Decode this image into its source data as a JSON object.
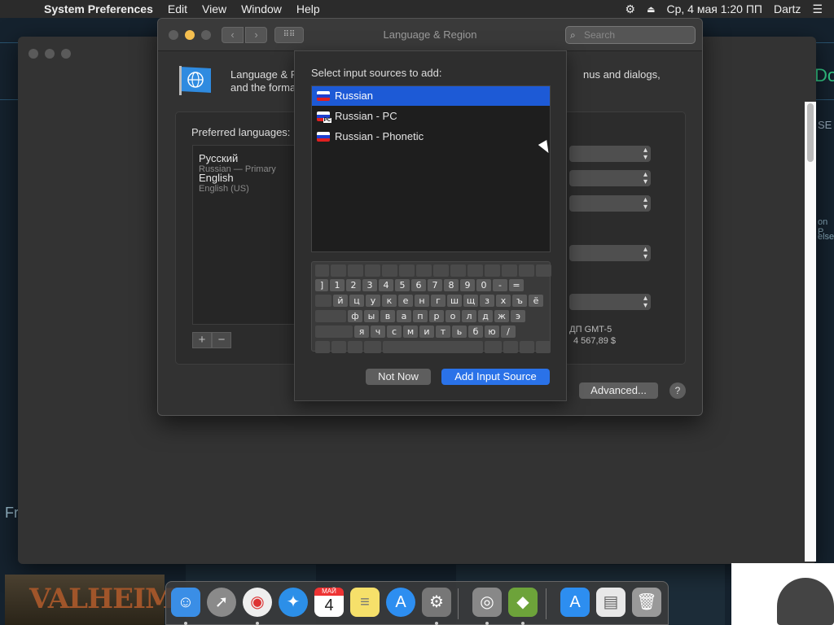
{
  "menubar": {
    "apple": "",
    "app_name": "System Preferences",
    "items": [
      "Edit",
      "View",
      "Window",
      "Help"
    ],
    "clock": "Ср, 4 мая  1:20 ПП",
    "user": "Dartz"
  },
  "window": {
    "title": "Language & Region",
    "search_placeholder": "Search",
    "header_text_line1": "Language & R",
    "header_text_line2": "and the forma",
    "header_text_right": "nus and dialogs,",
    "preferred_languages_label": "Preferred languages:",
    "languages": [
      {
        "name": "Русский",
        "sub": "Russian — Primary"
      },
      {
        "name": "English",
        "sub": "English (US)"
      }
    ],
    "region_time_text": "9 ДП GMT-5",
    "region_number_text": "4 567,89 $",
    "advanced_label": "Advanced...",
    "help_label": "?"
  },
  "sheet": {
    "title": "Select input sources to add:",
    "sources": [
      {
        "label": "Russian",
        "selected": true
      },
      {
        "label": "Russian - PC",
        "selected": false
      },
      {
        "label": "Russian - Phonetic",
        "selected": false
      }
    ],
    "keyboard_rows": [
      [
        "]",
        "1",
        "2",
        "3",
        "4",
        "5",
        "6",
        "7",
        "8",
        "9",
        "0",
        "-",
        "="
      ],
      [
        "й",
        "ц",
        "у",
        "к",
        "е",
        "н",
        "г",
        "ш",
        "щ",
        "з",
        "х",
        "ъ",
        "ё"
      ],
      [
        "ф",
        "ы",
        "в",
        "а",
        "п",
        "р",
        "о",
        "л",
        "д",
        "ж",
        "э"
      ],
      [
        "я",
        "ч",
        "с",
        "м",
        "и",
        "т",
        "ь",
        "б",
        "ю",
        "/"
      ]
    ],
    "not_now_label": "Not Now",
    "add_label": "Add Input Source"
  },
  "background": {
    "left_text": "Fr",
    "right_text_1": "on P",
    "right_text_2": "else",
    "right_text_3": "SE",
    "right_text_4": "Do",
    "game_banner": "VALHEIM"
  },
  "dock": {
    "calendar_month": "МАЙ",
    "calendar_day": "4",
    "icons": [
      "finder-icon",
      "launchpad-icon",
      "chrome-icon",
      "safari-icon",
      "calendar-icon",
      "notes-icon",
      "app-store-icon",
      "system-preferences-icon",
      "screenshot-icon",
      "vectorworks-icon",
      "app-store-folder-icon",
      "document-icon",
      "trash-icon"
    ]
  },
  "colors": {
    "selection": "#1d5ad6",
    "primary_button": "#2a72e8",
    "minimize": "#f5bf4f"
  }
}
